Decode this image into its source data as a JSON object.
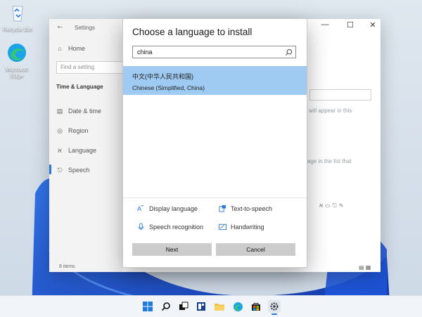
{
  "desktop": {
    "icons": [
      {
        "label": "Recycle Bin"
      },
      {
        "label": "Microsoft Edge"
      }
    ]
  },
  "settings_window": {
    "title": "Settings",
    "nav": {
      "home": "Home",
      "find_placeholder": "Find a setting",
      "section": "Time & Language",
      "items": [
        "Date & time",
        "Region",
        "Language",
        "Speech"
      ]
    },
    "status": "8 items",
    "background_text": {
      "line1": "rer will appear in this",
      "line2": "guage in the list that"
    }
  },
  "dialog": {
    "title": "Choose a language to install",
    "search": {
      "value": "china"
    },
    "result": {
      "native_name": "中文(中华人民共和国)",
      "english_name": "Chinese (Simplified, China)"
    },
    "legend": {
      "display_language": "Display language",
      "text_to_speech": "Text-to-speech",
      "speech_recognition": "Speech recognition",
      "handwriting": "Handwriting"
    },
    "buttons": {
      "next": "Next",
      "cancel": "Cancel"
    }
  },
  "colors": {
    "accent": "#2b79d6",
    "result_highlight": "#9fcaf2",
    "button": "#cccccc"
  }
}
